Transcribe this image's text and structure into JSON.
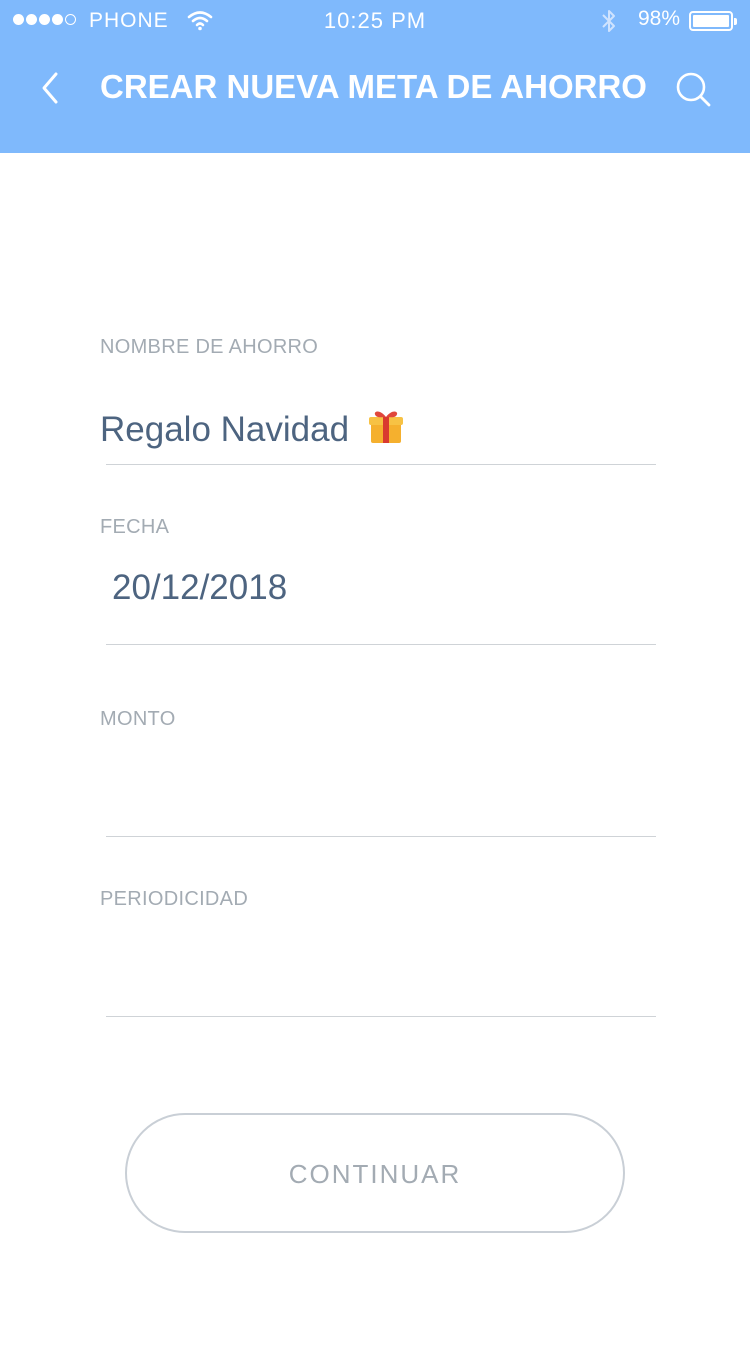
{
  "status_bar": {
    "carrier": "PHONE",
    "time": "10:25 PM",
    "battery_percent": "98%",
    "signal_bars_filled": 4,
    "signal_bars_total": 5,
    "icons": [
      "wifi-icon",
      "bluetooth-icon",
      "battery-icon"
    ]
  },
  "header": {
    "title": "CREAR NUEVA META DE AHORRO",
    "back_icon": "chevron-left-icon",
    "search_icon": "search-icon",
    "background_color": "#7fb9fc"
  },
  "form": {
    "nombre": {
      "label": "NOMBRE DE AHORRO",
      "value": "Regalo Navidad",
      "icon": "gift-icon"
    },
    "fecha": {
      "label": "FECHA",
      "value": "20/12/2018"
    },
    "monto": {
      "label": "MONTO",
      "value": ""
    },
    "periodicidad": {
      "label": "PERIODICIDAD",
      "value": ""
    }
  },
  "actions": {
    "continue_label": "CONTINUAR"
  },
  "colors": {
    "label": "#a3abb3",
    "value_text": "#4d6480",
    "divider": "#cfd3d7",
    "button_border": "#c9cfd6"
  }
}
